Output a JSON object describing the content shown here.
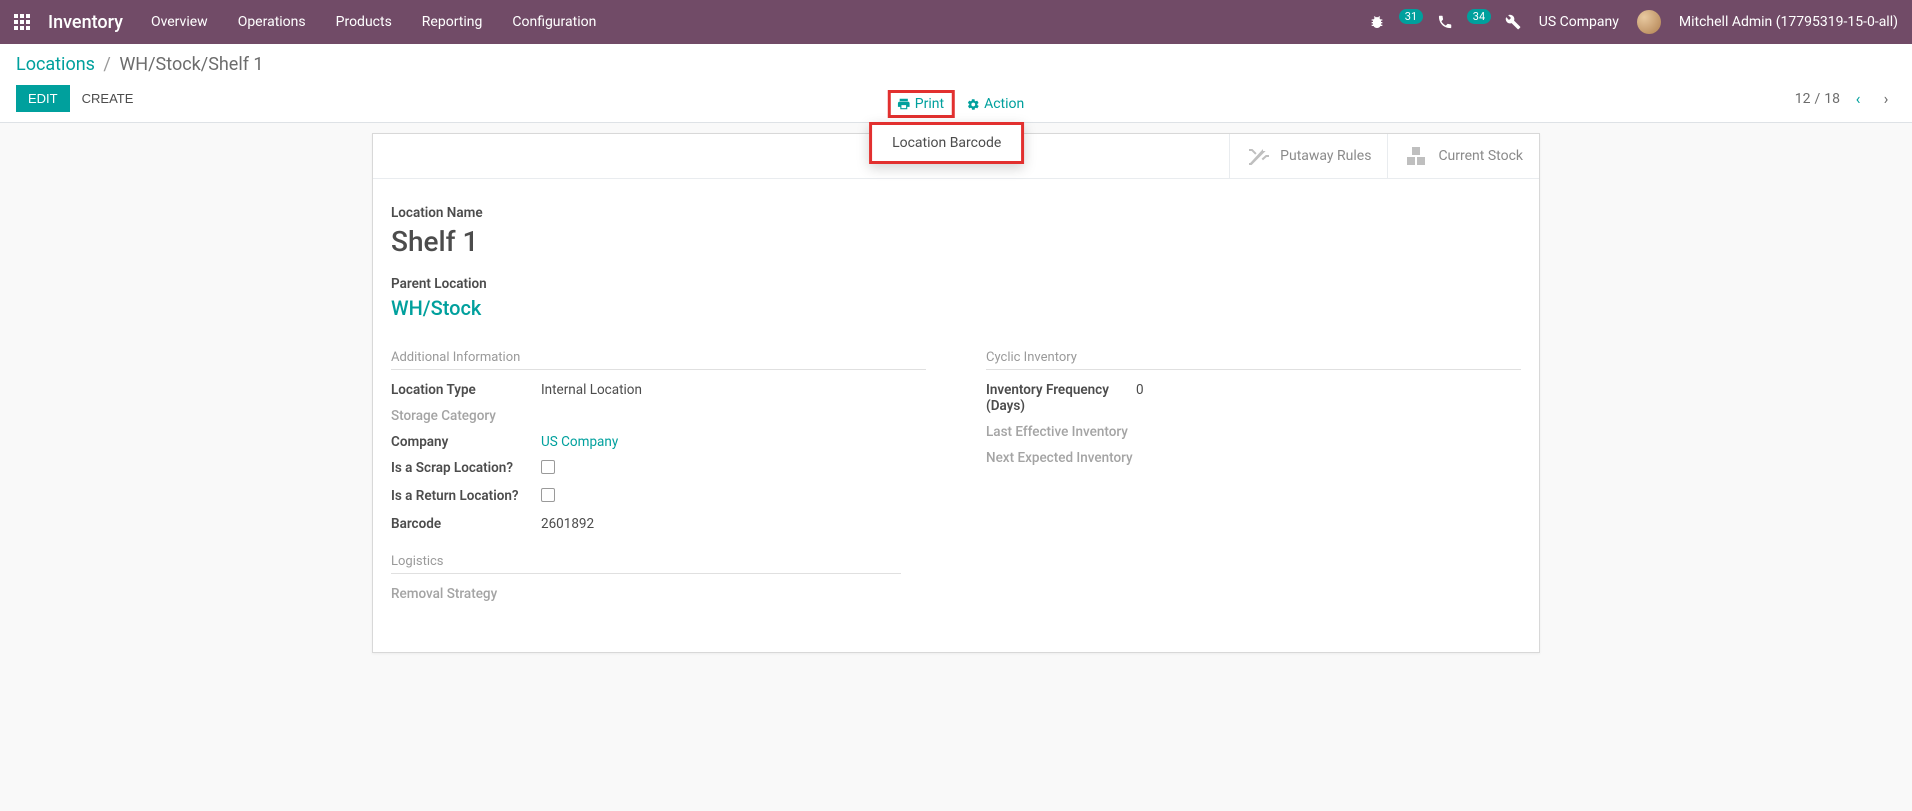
{
  "nav": {
    "brand": "Inventory",
    "menu": [
      "Overview",
      "Operations",
      "Products",
      "Reporting",
      "Configuration"
    ],
    "chat_badge": "31",
    "activity_badge": "34",
    "company": "US Company",
    "user": "Mitchell Admin (17795319-15-0-all)"
  },
  "breadcrumb": {
    "root": "Locations",
    "current": "WH/Stock/Shelf 1"
  },
  "buttons": {
    "edit": "EDIT",
    "create": "CREATE",
    "print": "Print",
    "action": "Action"
  },
  "dropdown": {
    "item": "Location Barcode"
  },
  "pager": {
    "pos": "12",
    "total": "18",
    "sep": " / "
  },
  "stats": {
    "putaway": "Putaway Rules",
    "current_stock": "Current Stock"
  },
  "form": {
    "location_name_label": "Location Name",
    "location_name": "Shelf 1",
    "parent_label": "Parent Location",
    "parent_value": "WH/Stock",
    "group_additional": "Additional Information",
    "location_type_label": "Location Type",
    "location_type_value": "Internal Location",
    "storage_category_label": "Storage Category",
    "company_label": "Company",
    "company_value": "US Company",
    "scrap_label": "Is a Scrap Location?",
    "return_label": "Is a Return Location?",
    "barcode_label": "Barcode",
    "barcode_value": "2601892",
    "group_cyclic": "Cyclic Inventory",
    "inv_freq_label": "Inventory Frequency (Days)",
    "inv_freq_value": "0",
    "last_eff_label": "Last Effective Inventory",
    "next_exp_label": "Next Expected Inventory",
    "group_logistics": "Logistics",
    "removal_label": "Removal Strategy"
  }
}
